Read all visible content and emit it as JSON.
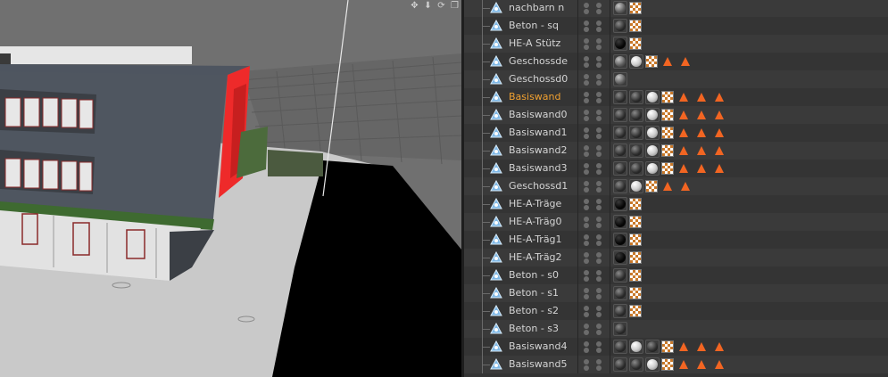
{
  "viewport": {
    "toolbar_icons": [
      "move-icon",
      "zoom-icon",
      "rotate-icon",
      "maximize-icon"
    ]
  },
  "object_manager": {
    "active_color": "#f0a030",
    "phong_color": "#f26522",
    "rows": [
      {
        "name": "nachbarn n",
        "active": false,
        "tags": [
          "gray",
          "checker"
        ]
      },
      {
        "name": "Beton - sq",
        "active": false,
        "tags": [
          "dark",
          "checker"
        ]
      },
      {
        "name": "HE-A Stütz",
        "active": false,
        "tags": [
          "black",
          "checker"
        ]
      },
      {
        "name": "Geschossde",
        "active": false,
        "tags": [
          "gray",
          "white",
          "checker",
          "phong",
          "phong"
        ]
      },
      {
        "name": "Geschossd0",
        "active": false,
        "tags": [
          "gray"
        ]
      },
      {
        "name": "Basiswand",
        "active": true,
        "tags": [
          "dark",
          "dark",
          "white",
          "checker",
          "phong",
          "phong",
          "phong"
        ]
      },
      {
        "name": "Basiswand0",
        "active": false,
        "tags": [
          "dark",
          "dark",
          "white",
          "checker",
          "phong",
          "phong",
          "phong"
        ]
      },
      {
        "name": "Basiswand1",
        "active": false,
        "tags": [
          "dark",
          "dark",
          "white",
          "checker",
          "phong",
          "phong",
          "phong"
        ]
      },
      {
        "name": "Basiswand2",
        "active": false,
        "tags": [
          "dark",
          "dark",
          "white",
          "checker",
          "phong",
          "phong",
          "phong"
        ]
      },
      {
        "name": "Basiswand3",
        "active": false,
        "tags": [
          "dark",
          "dark",
          "white",
          "checker",
          "phong",
          "phong",
          "phong"
        ]
      },
      {
        "name": "Geschossd1",
        "active": false,
        "tags": [
          "dark",
          "white",
          "checker",
          "phong",
          "phong"
        ]
      },
      {
        "name": "HE-A-Träge",
        "active": false,
        "tags": [
          "black",
          "checker"
        ]
      },
      {
        "name": "HE-A-Träg0",
        "active": false,
        "tags": [
          "black",
          "checker"
        ]
      },
      {
        "name": "HE-A-Träg1",
        "active": false,
        "tags": [
          "black",
          "checker"
        ]
      },
      {
        "name": "HE-A-Träg2",
        "active": false,
        "tags": [
          "black",
          "checker"
        ]
      },
      {
        "name": "Beton - s0",
        "active": false,
        "tags": [
          "dark",
          "checker"
        ]
      },
      {
        "name": "Beton - s1",
        "active": false,
        "tags": [
          "dark",
          "checker"
        ]
      },
      {
        "name": "Beton - s2",
        "active": false,
        "tags": [
          "dark",
          "checker"
        ]
      },
      {
        "name": "Beton - s3",
        "active": false,
        "tags": [
          "dark"
        ]
      },
      {
        "name": "Basiswand4",
        "active": false,
        "tags": [
          "dark",
          "white",
          "dark",
          "checker",
          "phong",
          "phong",
          "phong"
        ]
      },
      {
        "name": "Basiswand5",
        "active": false,
        "tags": [
          "dark",
          "dark",
          "white",
          "checker",
          "phong",
          "phong",
          "phong"
        ]
      }
    ]
  }
}
